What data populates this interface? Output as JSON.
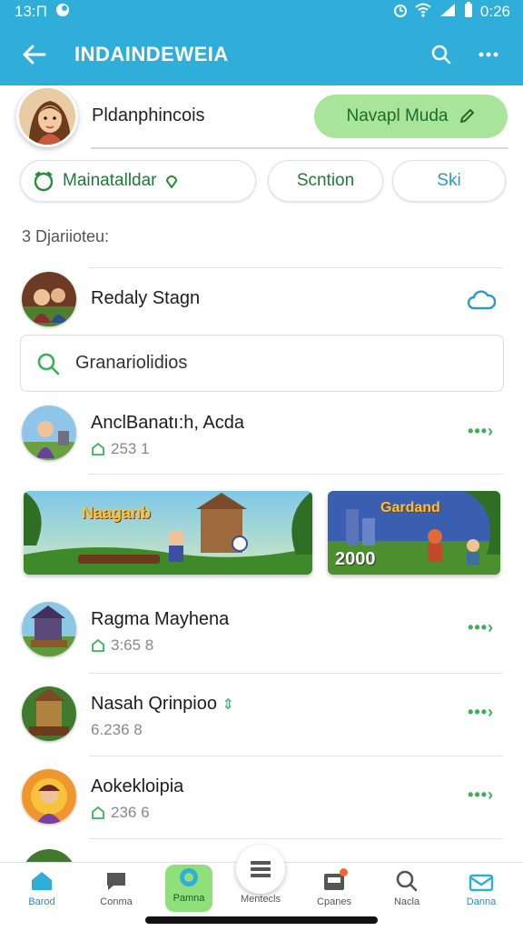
{
  "status_bar": {
    "time": "13:П",
    "right_time": "0:26"
  },
  "app_bar": {
    "title": "INDAINDEWEIA"
  },
  "profile": {
    "name": "Pldanphincois",
    "edit_label": "Navapl Muda"
  },
  "chips": [
    {
      "label": "Mainatalldar"
    },
    {
      "label": "Scntion"
    },
    {
      "label": "Ski"
    }
  ],
  "section_title": "3 Djariioteu:",
  "items": [
    {
      "name": "Redaly Stagn"
    },
    {
      "name": "AnclBanatı:h, Acda",
      "meta": "253 1"
    },
    {
      "name": "Ragma Mayhena",
      "meta": "3:65 8"
    },
    {
      "name": "Nasah Qrinpioo",
      "meta": "6.236 8"
    },
    {
      "name": "Aokekloipia",
      "meta": "236 6"
    }
  ],
  "search": {
    "value": "Granariolidios"
  },
  "banners": [
    {
      "title": "Naaganb"
    },
    {
      "title": "Gardand",
      "number": "2000"
    }
  ],
  "more_label": "•••›",
  "bottom_nav": [
    {
      "label": "Barod",
      "icon": "home-icon"
    },
    {
      "label": "Conma",
      "icon": "chat-icon"
    },
    {
      "label": "Pamna",
      "icon": "globe-icon"
    },
    {
      "label": "Mentecls",
      "icon": "list-icon"
    },
    {
      "label": "Cpanes",
      "icon": "inbox-icon"
    },
    {
      "label": "Nacla",
      "icon": "search-icon"
    },
    {
      "label": "Danna",
      "icon": "mail-icon"
    }
  ],
  "colors": {
    "primary": "#2eaed9",
    "accent_green": "#3bb05b",
    "chip_green": "#a8e49a"
  }
}
